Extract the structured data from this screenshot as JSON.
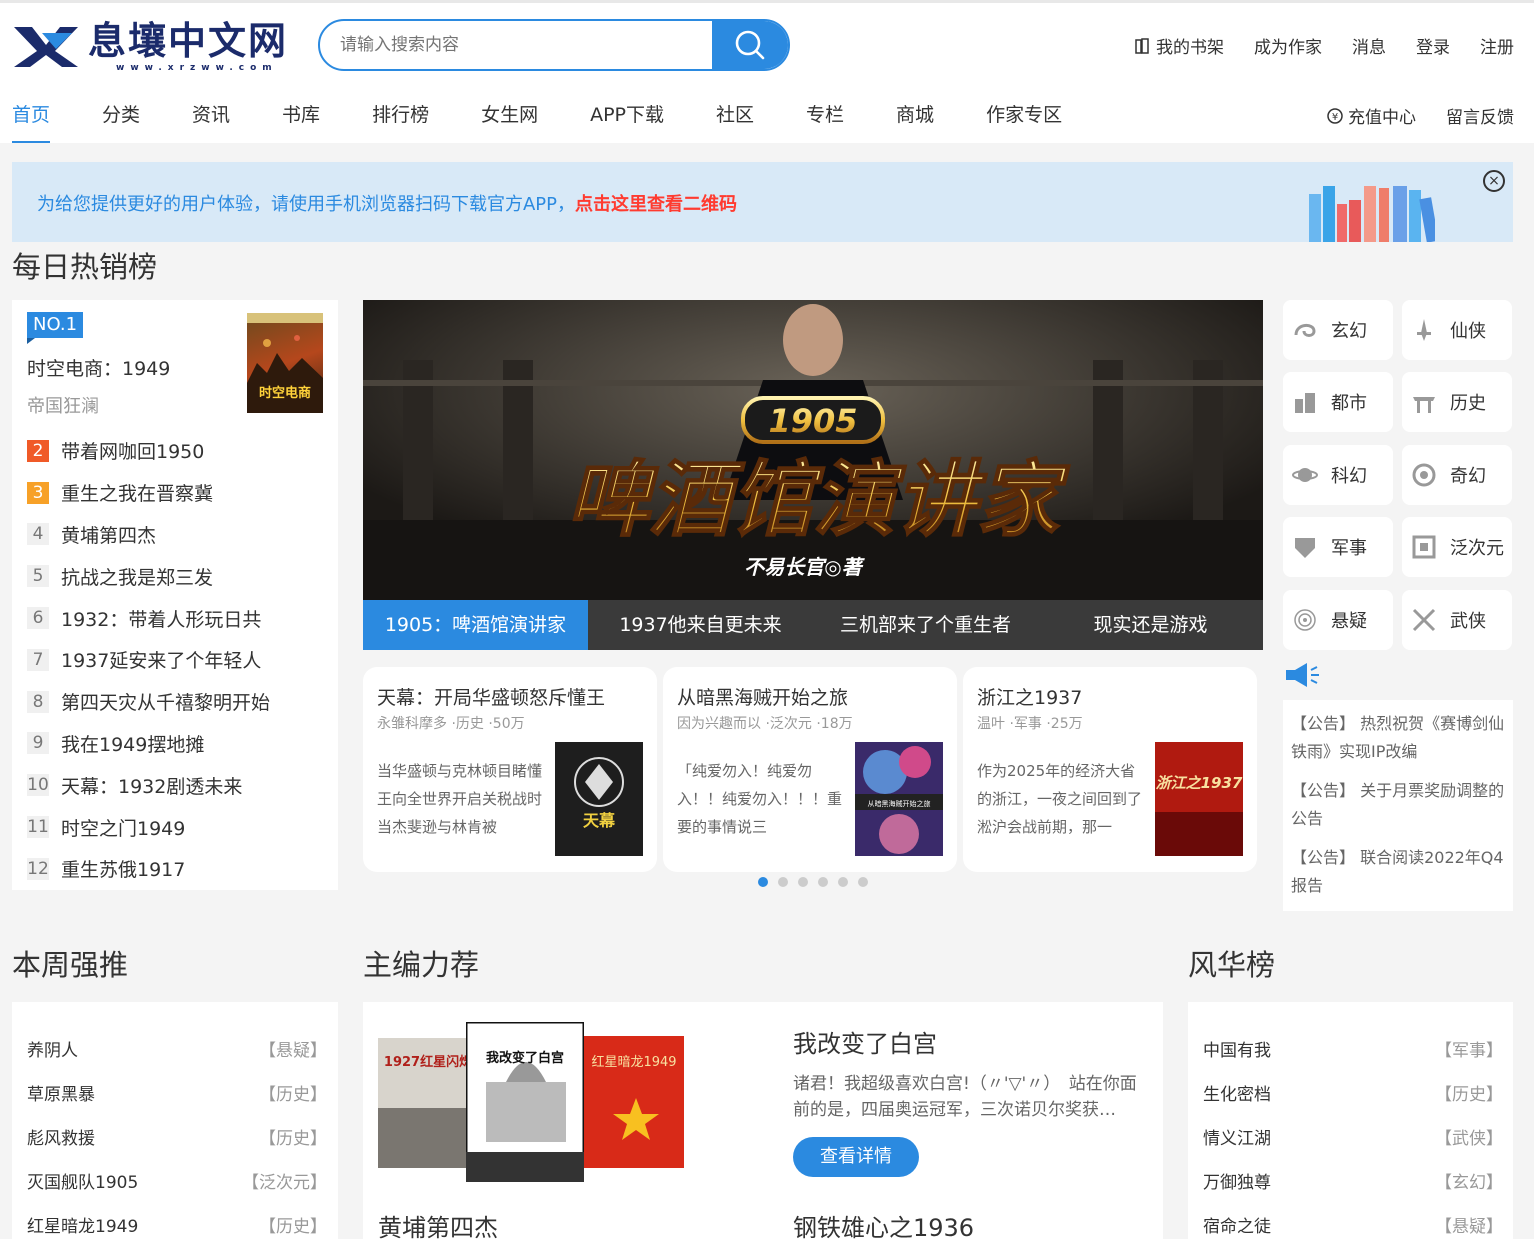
{
  "header": {
    "logo_text": "息壤中文网",
    "logo_url": "www.xrzww.com",
    "search_placeholder": "请输入搜索内容",
    "links": [
      "我的书架",
      "成为作家",
      "消息",
      "登录",
      "注册"
    ]
  },
  "nav": {
    "items": [
      "首页",
      "分类",
      "资讯",
      "书库",
      "排行榜",
      "女生网",
      "APP下载",
      "社区",
      "专栏",
      "商城",
      "作家专区"
    ],
    "right": [
      "充值中心",
      "留言反馈"
    ]
  },
  "banner": {
    "text": "为给您提供更好的用户体验，请使用手机浏览器扫码下载官方APP，",
    "link": "点击这里查看二维码",
    "close_symbol": "×"
  },
  "daily": {
    "title": "每日热销榜",
    "top_badge": "NO.1",
    "top_title": "时空电商：1949",
    "top_author": "帝国狂澜",
    "top_cover_text": "时空电商",
    "items": [
      {
        "num": "2",
        "title": "带着网咖回1950"
      },
      {
        "num": "3",
        "title": "重生之我在晋察冀"
      },
      {
        "num": "4",
        "title": "黄埔第四杰"
      },
      {
        "num": "5",
        "title": "抗战之我是郑三发"
      },
      {
        "num": "6",
        "title": "1932：带着人形玩日共"
      },
      {
        "num": "7",
        "title": "1937延安来了个年轻人"
      },
      {
        "num": "8",
        "title": "第四天灾从千禧黎明开始"
      },
      {
        "num": "9",
        "title": "我在1949摆地摊"
      },
      {
        "num": "10",
        "title": "天幕：1932剧透未来"
      },
      {
        "num": "11",
        "title": "时空之门1949"
      },
      {
        "num": "12",
        "title": "重生苏俄1917"
      }
    ]
  },
  "carousel": {
    "image_number": "1905",
    "image_title": "啤酒馆演讲家",
    "image_author": "不易长官◎著",
    "tabs": [
      "1905：啤酒馆演讲家",
      "1937他来自更未来",
      "三机部来了个重生者",
      "现实还是游戏"
    ]
  },
  "cards": [
    {
      "title": "天幕：开局华盛顿怒斥懂王",
      "meta": "永雏科摩多 ·历史 ·50万",
      "desc": "当华盛顿与克林顿目睹懂王向全世界开启关税战时 当杰斐逊与林肯被",
      "cover_text": "天幕"
    },
    {
      "title": "从暗黑海贼开始之旅",
      "meta": "因为兴趣而以 ·泛次元 ·18万",
      "desc": "「纯爱勿入！纯爱勿入！！纯爱勿入！！！重要的事情说三",
      "cover_text": "从暗黑海贼开始之旅"
    },
    {
      "title": "浙江之1937",
      "meta": "温叶 ·军事 ·25万",
      "desc": "作为2025年的经济大省的浙江，一夜之间回到了淞沪会战前期，那一",
      "cover_text": "浙江之1937"
    }
  ],
  "categories": [
    "玄幻",
    "仙侠",
    "都市",
    "历史",
    "科幻",
    "奇幻",
    "军事",
    "泛次元",
    "悬疑",
    "武侠"
  ],
  "notices": [
    "【公告】 热烈祝贺《赛博剑仙铁雨》实现IP改编",
    "【公告】 关于月票奖励调整的公告",
    "【公告】 联合阅读2022年Q4报告"
  ],
  "weekly": {
    "title": "本周强推",
    "items": [
      {
        "title": "养阴人",
        "tag": "【悬疑】"
      },
      {
        "title": "草原黑暴",
        "tag": "【历史】"
      },
      {
        "title": "彪风救援",
        "tag": "【历史】"
      },
      {
        "title": "灭国舰队1905",
        "tag": "【泛次元】"
      },
      {
        "title": "红星暗龙1949",
        "tag": "【历史】"
      }
    ]
  },
  "editor": {
    "title": "主编力荐",
    "book_title": "我改变了白宫",
    "book_desc": "诸君！我超级喜欢白宫!（〃'▽'〃）　站在你面前的是，四届奥运冠军，三次诺贝尔奖获…",
    "button": "查看详情",
    "cover_texts": [
      "1927红星闪烁",
      "我改变了白宫",
      "红星暗龙1949"
    ],
    "bottom_left": "黄埔第四杰",
    "bottom_right": "钢铁雄心之1936"
  },
  "fenghua": {
    "title": "风华榜",
    "items": [
      {
        "title": "中国有我",
        "tag": "【军事】"
      },
      {
        "title": "生化密档",
        "tag": "【历史】"
      },
      {
        "title": "情义江湖",
        "tag": "【武侠】"
      },
      {
        "title": "万御独尊",
        "tag": "【玄幻】"
      },
      {
        "title": "宿命之徒",
        "tag": "【悬疑】"
      }
    ]
  },
  "colors": {
    "accent": "#2b8ae0",
    "warn": "#ff3b30",
    "rank2": "#f05a28",
    "rank3": "#f7a128"
  }
}
